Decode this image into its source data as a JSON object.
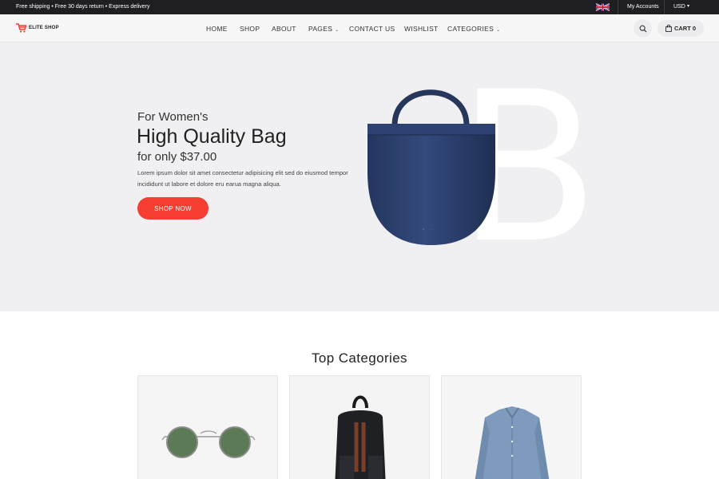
{
  "topbar": {
    "promo": "Free shipping • Free 30 days return • Express delivery",
    "flag_icon": "uk-flag-icon",
    "accounts_label": "My Accounts",
    "currency": "USD"
  },
  "header": {
    "logo_text": "ELITE SHOP",
    "nav": [
      {
        "label": "HOME"
      },
      {
        "label": "SHOP"
      },
      {
        "label": "ABOUT"
      },
      {
        "label": "PAGES"
      },
      {
        "label": "CONTACT US"
      },
      {
        "label": "WISHLIST"
      },
      {
        "label": "CATEGORIES"
      }
    ],
    "cart_label": "CART 0"
  },
  "hero": {
    "kicker": "For Women's",
    "title": "High Quality Bag",
    "price": "for only $37.00",
    "description": "Lorem ipsum dolor sit amet consectetur adipisicing elit sed do eiusmod tempor incididunt ut labore et dolore eru earua magna aliqua.",
    "cta": "SHOP NOW",
    "background_letter": "B",
    "accent_color": "#f53d31"
  },
  "categories": {
    "title": "Top Categories",
    "items": [
      {
        "icon": "sunglasses-image"
      },
      {
        "icon": "backpack-image"
      },
      {
        "icon": "denim-shirt-image"
      }
    ]
  }
}
